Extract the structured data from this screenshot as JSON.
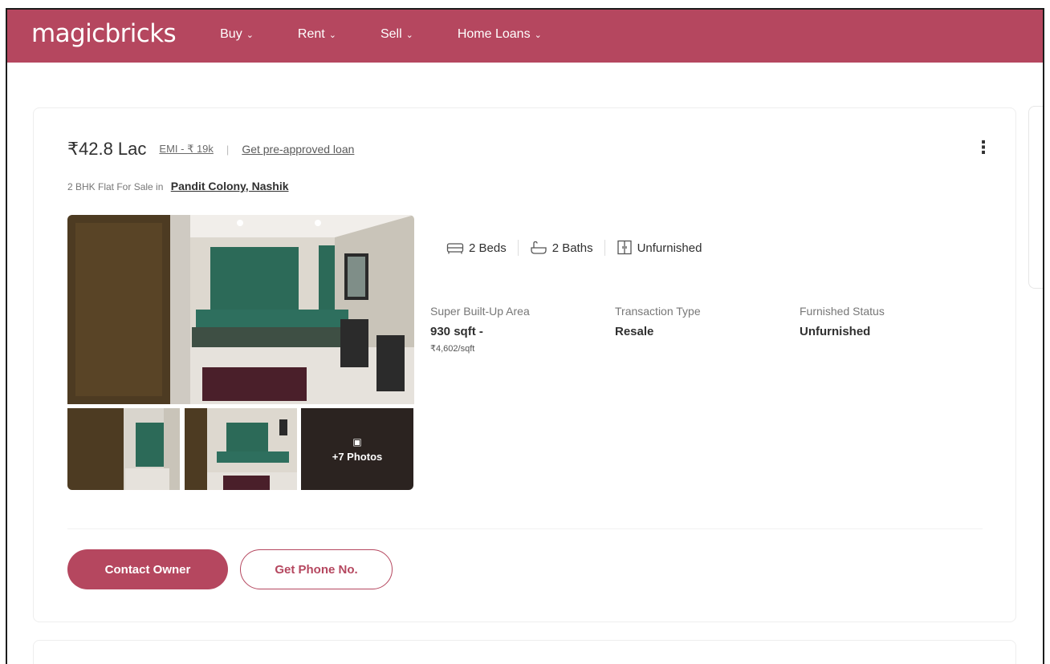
{
  "brand": {
    "logo_text": "magicbricks",
    "color": "#b5475f"
  },
  "nav": {
    "items": [
      {
        "label": "Buy"
      },
      {
        "label": "Rent"
      },
      {
        "label": "Sell"
      },
      {
        "label": "Home Loans"
      }
    ]
  },
  "listing": {
    "price": "₹42.8 Lac",
    "emi": "EMI - ₹ 19k",
    "separator": "|",
    "loan_link": "Get pre-approved loan",
    "title_prefix": "2 BHK Flat For Sale in",
    "location": "Pandit Colony, Nashik",
    "more_photos": "+7 Photos",
    "features": [
      {
        "icon": "bed-icon",
        "label": "2 Beds"
      },
      {
        "icon": "bath-icon",
        "label": "2 Baths"
      },
      {
        "icon": "wardrobe-icon",
        "label": "Unfurnished"
      }
    ],
    "summary": [
      {
        "label": "Super Built-Up Area",
        "value": "930 sqft -",
        "sub": "₹4,602/sqft"
      },
      {
        "label": "Transaction Type",
        "value": "Resale"
      },
      {
        "label": "Furnished Status",
        "value": "Unfurnished"
      }
    ],
    "buttons": {
      "contact": "Contact Owner",
      "phone": "Get Phone No."
    }
  }
}
